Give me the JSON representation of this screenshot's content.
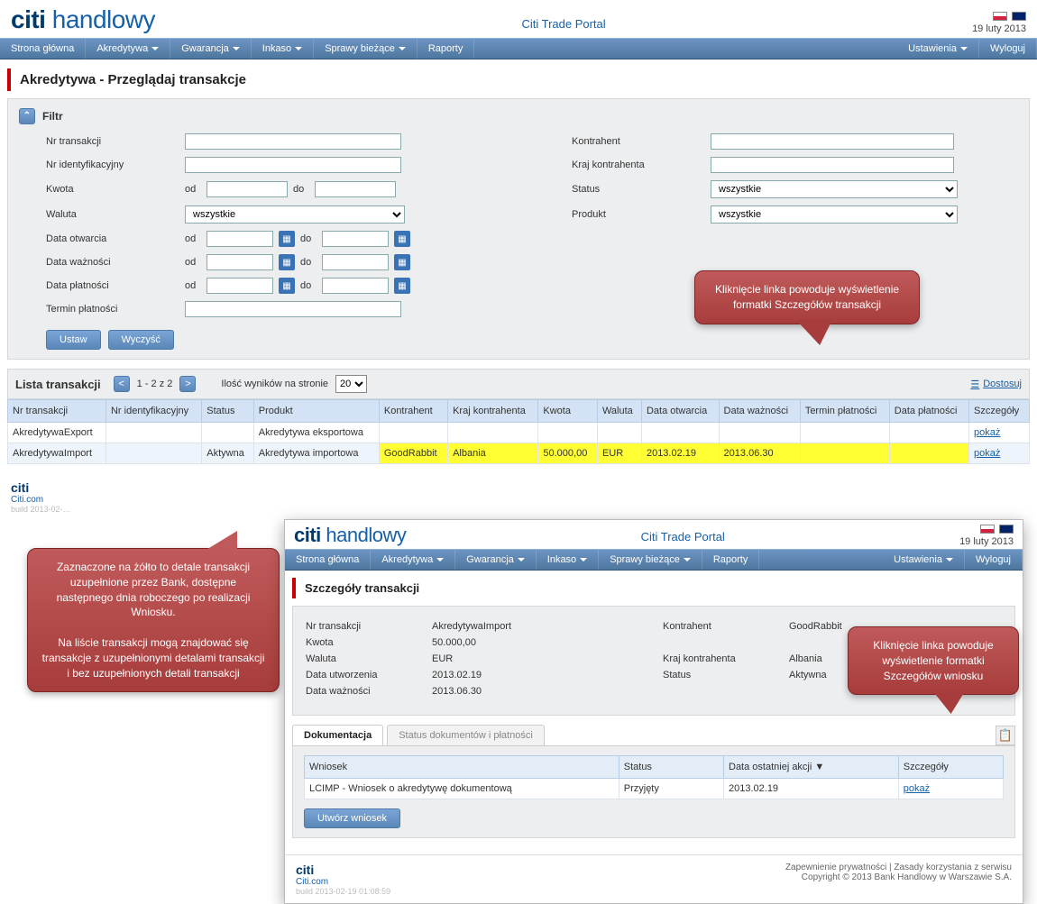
{
  "brand": {
    "citi": "citi",
    "sub": "handlowy",
    "portal": "Citi Trade Portal"
  },
  "date": "19 luty 2013",
  "menu": [
    "Strona główna",
    "Akredytywa",
    "Gwarancja",
    "Inkaso",
    "Sprawy bieżące",
    "Raporty"
  ],
  "menu_right": [
    "Ustawienia",
    "Wyloguj"
  ],
  "menu_has_dropdown": [
    false,
    true,
    true,
    true,
    true,
    false
  ],
  "menu_right_has_dropdown": [
    true,
    false
  ],
  "page_title": "Akredytywa - Przeglądaj transakcje",
  "filter": {
    "heading": "Filtr",
    "labels": {
      "nrTransakcji": "Nr transakcji",
      "kontrahent": "Kontrahent",
      "nrIdent": "Nr identyfikacyjny",
      "krajKontrahenta": "Kraj kontrahenta",
      "kwota": "Kwota",
      "od": "od",
      "do": "do",
      "status": "Status",
      "waluta": "Waluta",
      "produkt": "Produkt",
      "dataOtwarcia": "Data otwarcia",
      "dataWaznosci": "Data ważności",
      "dataPlatnosci": "Data płatności",
      "terminPlatnosci": "Termin płatności"
    },
    "all_option": "wszystkie",
    "buttons": {
      "ustaw": "Ustaw",
      "wyczysc": "Wyczyść"
    }
  },
  "list": {
    "title": "Lista transakcji",
    "pager": "1 - 2 z 2",
    "perPageLabel": "Ilość wyników na stronie",
    "perPage": "20",
    "dostosuj": "Dostosuj",
    "columns": [
      "Nr transakcji",
      "Nr identyfikacyjny",
      "Status",
      "Produkt",
      "Kontrahent",
      "Kraj kontrahenta",
      "Kwota",
      "Waluta",
      "Data otwarcia",
      "Data ważności",
      "Termin płatności",
      "Data płatności",
      "Szczegóły"
    ],
    "rows": [
      {
        "nr": "AkredytywaExport",
        "ident": "",
        "status": "",
        "produkt": "Akredytywa eksportowa",
        "kontrahent": "",
        "kraj": "",
        "kwota": "",
        "waluta": "",
        "otw": "",
        "waz": "",
        "termin": "",
        "plat": "",
        "link": "pokaż",
        "highlight": false
      },
      {
        "nr": "AkredytywaImport",
        "ident": "",
        "status": "Aktywna",
        "produkt": "Akredytywa importowa",
        "kontrahent": "GoodRabbit",
        "kraj": "Albania",
        "kwota": "50.000,00",
        "waluta": "EUR",
        "otw": "2013.02.19",
        "waz": "2013.06.30",
        "termin": "",
        "plat": "",
        "link": "pokaż",
        "highlight": true
      }
    ]
  },
  "callouts": {
    "c1": "Kliknięcie linka powoduje wyświetlenie formatki Szczegółów transakcji",
    "c2": "Zaznaczone na żółto to detale transakcji uzupełnione przez Bank, dostępne następnego dnia roboczego po realizacji Wniosku.\n\nNa liście transakcji mogą znajdować się transakcje z uzupełnionymi detalami transakcji i bez uzupełnionych detali transakcji",
    "c3": "Kliknięcie linka powoduje wyświetlenie formatki Szczegółów wniosku"
  },
  "inner": {
    "page_title": "Szczegóły transakcji",
    "fields": {
      "nrTransakcji_l": "Nr transakcji",
      "nrTransakcji_v": "AkredytywaImport",
      "kontrahent_l": "Kontrahent",
      "kontrahent_v": "GoodRabbit",
      "kwota_l": "Kwota",
      "kwota_v": "50.000,00",
      "waluta_l": "Waluta",
      "waluta_v": "EUR",
      "krajK_l": "Kraj kontrahenta",
      "krajK_v": "Albania",
      "dataUtw_l": "Data utworzenia",
      "dataUtw_v": "2013.02.19",
      "status_l": "Status",
      "status_v": "Aktywna",
      "dataWaz_l": "Data ważności",
      "dataWaz_v": "2013.06.30"
    },
    "tabs": [
      "Dokumentacja",
      "Status dokumentów i płatności"
    ],
    "grid": {
      "columns": [
        "Wniosek",
        "Status",
        "Data ostatniej akcji ▼",
        "Szczegóły"
      ],
      "row": {
        "wniosek": "LCIMP - Wniosek o akredytywę dokumentową",
        "status": "Przyjęty",
        "data": "2013.02.19",
        "link": "pokaż"
      }
    },
    "btn_utworz": "Utwórz wniosek"
  },
  "footer": {
    "citi_com": "Citi.com",
    "build": "build 2013-02-19 01:08:59",
    "legal1": "Zapewnienie prywatności  |  Zasady korzystania z serwisu",
    "legal2": "Copyright © 2013 Bank Handlowy w Warszawie S.A."
  }
}
